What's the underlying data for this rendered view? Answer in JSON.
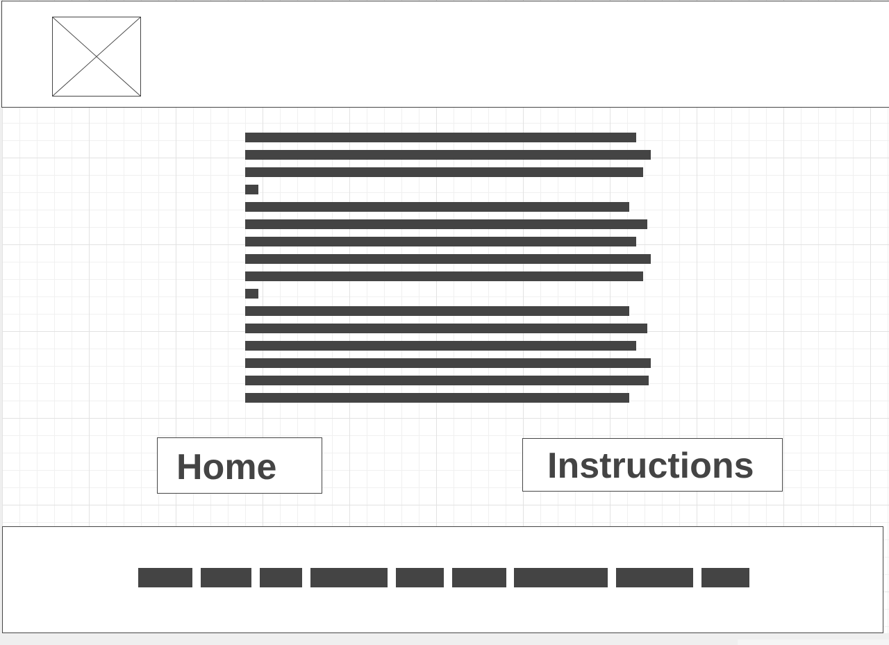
{
  "header": {
    "logo_icon": "image-placeholder-icon"
  },
  "buttons": {
    "home_label": "Home",
    "instructions_label": "Instructions"
  },
  "colors": {
    "ink": "#444444",
    "grid": "#e2e2e2",
    "background": "#ffffff"
  }
}
